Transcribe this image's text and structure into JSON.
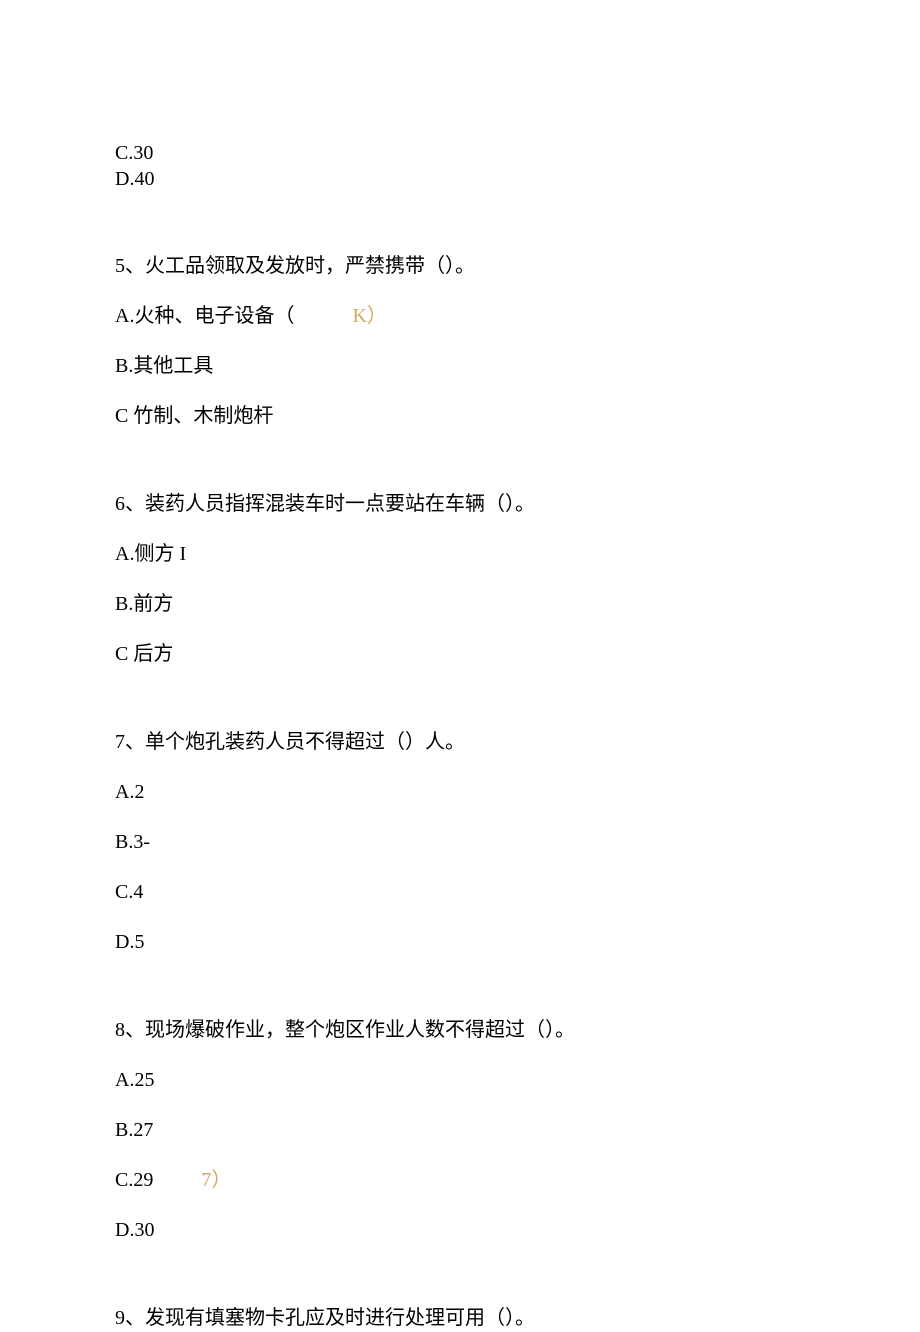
{
  "prev": {
    "optC": "C.30",
    "optD": "D.40"
  },
  "q5": {
    "question": "5、火工品领取及发放时，严禁携带（）。",
    "optA_prefix": "A.火种、电子设备（",
    "optA_annotation": "K）",
    "optB": "B.其他工具",
    "optC": "C 竹制、木制炮杆"
  },
  "q6": {
    "question": "6、装药人员指挥混装车时一点要站在车辆（）。",
    "optA": "A.侧方 I",
    "optB": "B.前方",
    "optC": "C 后方"
  },
  "q7": {
    "question": "7、单个炮孔装药人员不得超过（）人。",
    "optA": "A.2",
    "optB": "B.3-",
    "optC": "C.4",
    "optD": "D.5"
  },
  "q8": {
    "question": "8、现场爆破作业，整个炮区作业人数不得超过（）。",
    "optA": "A.25",
    "optB": "B.27",
    "optC_prefix": "C.29",
    "optC_annotation": "7）",
    "optD": "D.30"
  },
  "q9": {
    "question": "9、发现有填塞物卡孔应及时进行处理可用（）。"
  }
}
